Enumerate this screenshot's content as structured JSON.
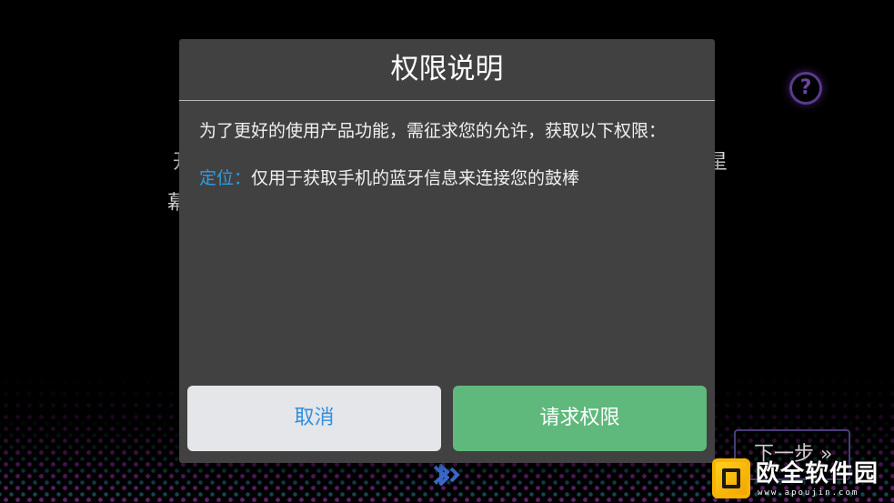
{
  "background": {
    "left_text_1": "开",
    "left_text_2": "幕",
    "right_text": "星",
    "next_button_label": "下一步 »",
    "help_icon": "help-circle-icon",
    "bluetooth_icon": "bluetooth-icon"
  },
  "dialog": {
    "title": "权限说明",
    "description": "为了更好的使用产品功能，需征求您的允许，获取以下权限：",
    "permissions": [
      {
        "name": "定位：",
        "description": "仅用于获取手机的蓝牙信息来连接您的鼓棒"
      }
    ],
    "cancel_label": "取消",
    "confirm_label": "请求权限"
  },
  "watermark": {
    "text": "欧全软件园",
    "url": "www.apoujin.com"
  },
  "colors": {
    "dialog_bg": "#414141",
    "accent_blue": "#2a9ee6",
    "confirm_green": "#5fb97c",
    "cancel_bg": "#e5e6e9"
  }
}
